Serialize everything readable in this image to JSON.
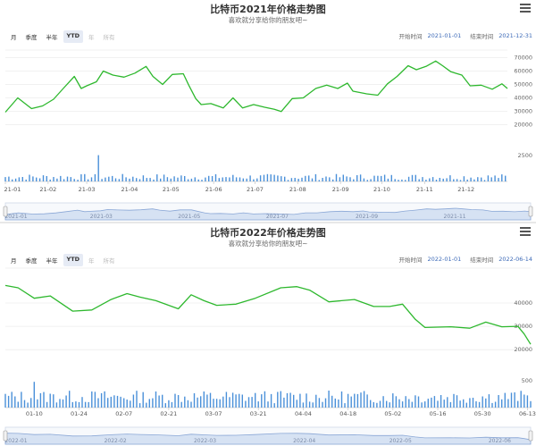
{
  "charts": [
    {
      "title": "比特币2021年价格走势图",
      "subtitle": "喜欢就分享给你的朋友吧~",
      "range_buttons": [
        "月",
        "季度",
        "半年",
        "YTD",
        "年",
        "所有"
      ],
      "selected_range": "YTD",
      "disabled_ranges": [
        "年",
        "所有"
      ],
      "start_label": "开始时间",
      "start_value": "2021-01-01",
      "end_label": "结束时间",
      "end_value": "2021-12-31"
    },
    {
      "title": "比特币2022年价格走势图",
      "subtitle": "喜欢就分享给你的朋友吧~",
      "range_buttons": [
        "月",
        "季度",
        "半年",
        "YTD",
        "年",
        "所有"
      ],
      "selected_range": "YTD",
      "disabled_ranges": [
        "年",
        "所有"
      ],
      "start_label": "开始时间",
      "start_value": "2022-01-01",
      "end_label": "结束时间",
      "end_value": "2022-06-14"
    }
  ],
  "colors": {
    "price_line": "#2eb82e",
    "volume_bar": "#4a90d9",
    "navigator_fill": "#d6e2f3",
    "navigator_line": "#8aa7d6",
    "accent": "#3e6bb8"
  },
  "chart_data": [
    {
      "type": "line",
      "title": "比特币2021年价格走势图",
      "price": {
        "x": [
          "2021-01-01",
          "2021-01-10",
          "2021-01-20",
          "2021-01-28",
          "2021-02-05",
          "2021-02-12",
          "2021-02-20",
          "2021-02-25",
          "2021-03-01",
          "2021-03-08",
          "2021-03-13",
          "2021-03-20",
          "2021-03-28",
          "2021-04-05",
          "2021-04-13",
          "2021-04-18",
          "2021-04-25",
          "2021-05-02",
          "2021-05-10",
          "2021-05-14",
          "2021-05-19",
          "2021-05-23",
          "2021-05-30",
          "2021-06-08",
          "2021-06-15",
          "2021-06-22",
          "2021-06-30",
          "2021-07-08",
          "2021-07-15",
          "2021-07-20",
          "2021-07-28",
          "2021-08-05",
          "2021-08-14",
          "2021-08-22",
          "2021-08-30",
          "2021-09-06",
          "2021-09-10",
          "2021-09-20",
          "2021-09-28",
          "2021-10-05",
          "2021-10-12",
          "2021-10-20",
          "2021-10-26",
          "2021-11-02",
          "2021-11-09",
          "2021-11-14",
          "2021-11-20",
          "2021-11-28",
          "2021-12-04",
          "2021-12-12",
          "2021-12-20",
          "2021-12-27",
          "2021-12-31"
        ],
        "y": [
          29300,
          40000,
          32000,
          34000,
          39000,
          47000,
          56000,
          47000,
          49000,
          52000,
          60000,
          57000,
          55500,
          58500,
          63500,
          56000,
          50000,
          57500,
          58000,
          49500,
          39500,
          35000,
          35700,
          32500,
          40000,
          32500,
          35000,
          33000,
          31500,
          29800,
          39500,
          40000,
          47000,
          49500,
          47000,
          51000,
          45000,
          43000,
          42000,
          50500,
          56000,
          64000,
          61000,
          63500,
          67500,
          64000,
          59500,
          57000,
          49000,
          49500,
          46500,
          50500,
          47000
        ]
      },
      "volume": {
        "max_label": 2500,
        "spike_date": "2021-03-10"
      },
      "x_tick_labels": [
        "21-01",
        "21-02",
        "21-03",
        "21-04",
        "21-05",
        "21-06",
        "21-07",
        "21-08",
        "21-09",
        "21-10",
        "21-11",
        "21-12"
      ],
      "y_ticks": [
        20000,
        30000,
        40000,
        50000,
        60000,
        70000
      ],
      "volume_ticks": [
        2500
      ],
      "navigator_labels": [
        "2021-01",
        "2021-03",
        "2021-05",
        "2021-07",
        "2021-09",
        "2021-11"
      ]
    },
    {
      "type": "line",
      "title": "比特币2022年价格走势图",
      "price": {
        "x": [
          "2022-01-01",
          "2022-01-05",
          "2022-01-10",
          "2022-01-15",
          "2022-01-22",
          "2022-01-28",
          "2022-02-03",
          "2022-02-08",
          "2022-02-12",
          "2022-02-17",
          "2022-02-24",
          "2022-02-28",
          "2022-03-04",
          "2022-03-08",
          "2022-03-14",
          "2022-03-20",
          "2022-03-28",
          "2022-04-02",
          "2022-04-06",
          "2022-04-12",
          "2022-04-20",
          "2022-04-26",
          "2022-05-01",
          "2022-05-05",
          "2022-05-09",
          "2022-05-12",
          "2022-05-20",
          "2022-05-26",
          "2022-05-31",
          "2022-06-05",
          "2022-06-10",
          "2022-06-12",
          "2022-06-14"
        ],
        "y": [
          47500,
          46500,
          42000,
          43000,
          36500,
          37000,
          41500,
          44000,
          42500,
          41000,
          37500,
          43500,
          41000,
          39000,
          39500,
          42000,
          46500,
          47000,
          45500,
          40500,
          41500,
          38500,
          38500,
          39500,
          33000,
          29500,
          29800,
          29200,
          31800,
          29800,
          30000,
          26700,
          22300
        ]
      },
      "volume": {
        "max_label": 500,
        "spike_date": "2022-01-10"
      },
      "x_tick_labels": [
        "01-10",
        "01-24",
        "02-07",
        "02-21",
        "03-07",
        "03-21",
        "04-04",
        "04-18",
        "05-02",
        "05-16",
        "05-30",
        "06-13"
      ],
      "y_ticks": [
        20000,
        30000,
        40000
      ],
      "volume_ticks": [
        500
      ],
      "navigator_labels": [
        "2022-01",
        "2022-02",
        "2022-03",
        "2022-04",
        "2022-05",
        "2022-06"
      ]
    }
  ]
}
